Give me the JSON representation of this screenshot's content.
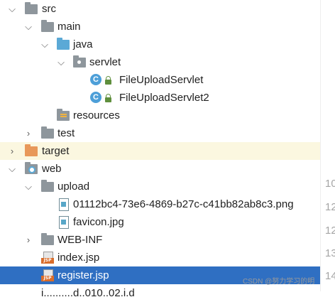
{
  "tree": {
    "src": "src",
    "main": "main",
    "java": "java",
    "servlet": "servlet",
    "class1": "FileUploadServlet",
    "class2": "FileUploadServlet2",
    "resources": "resources",
    "test": "test",
    "target": "target",
    "web": "web",
    "upload": "upload",
    "png_file": "01112bc4-73e6-4869-b27c-c41bb82ab8c3.png",
    "favicon": "favicon.jpg",
    "webinf": "WEB-INF",
    "index": "index.jsp",
    "register": "register.jsp",
    "cut_off": "i..........d..010..02.i.d"
  },
  "icons": {
    "class_letter": "C",
    "jsp_tag": "JSP",
    "expanded": "expanded-chevron",
    "collapsed": "collapsed-chevron"
  },
  "gutter": [
    "10",
    "12",
    "12",
    "13",
    "14"
  ],
  "watermark": "CSDN @努力学习的明",
  "colors": {
    "selection": "#2f6fc2",
    "target_highlight": "#fbf7e0",
    "folder_gray": "#8e969c",
    "folder_blue": "#5ba9d6",
    "folder_orange": "#e8985a",
    "class_icon": "#4d9fd8",
    "jsp_tag": "#d96d2b"
  }
}
